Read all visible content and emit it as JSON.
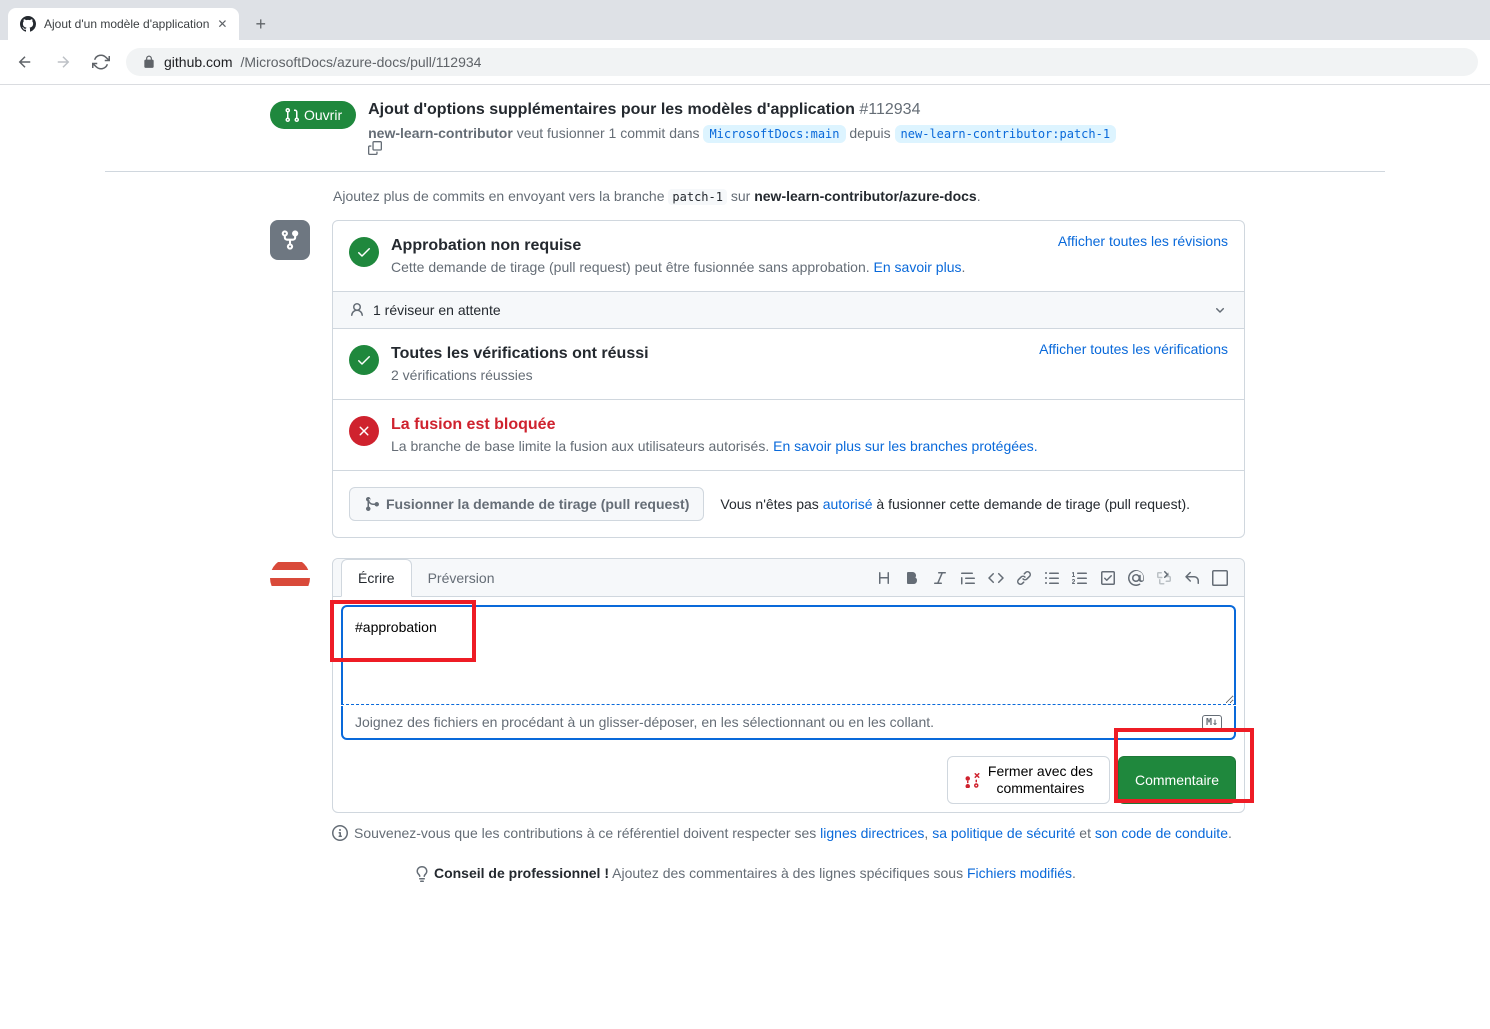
{
  "browser": {
    "tab_title": "Ajout d'un modèle d'application",
    "url_host": "github.com",
    "url_path": "/MicrosoftDocs/azure-docs/pull/112934"
  },
  "pr": {
    "status_label": "Ouvrir",
    "title": "Ajout d'options supplémentaires pour les modèles d'application",
    "number": "#112934",
    "author": "new-learn-contributor",
    "wants_merge": "veut fusionner 1 commit dans",
    "base_branch": "MicrosoftDocs:main",
    "from_word": "depuis",
    "head_branch": "new-learn-contributor:patch-1"
  },
  "commit_hint": {
    "prefix": "Ajoutez plus de commits en envoyant vers la branche",
    "branch": "patch-1",
    "on": "sur",
    "repo": "new-learn-contributor/azure-docs"
  },
  "approval": {
    "title": "Approbation non requise",
    "desc": "Cette demande de tirage (pull request) peut être fusionnée sans approbation.",
    "learn_more": "En savoir plus",
    "action": "Afficher toutes les révisions"
  },
  "reviewer_bar": "1 réviseur en attente",
  "checks": {
    "title": "Toutes les vérifications ont réussi",
    "desc": "2 vérifications réussies",
    "action": "Afficher toutes les vérifications"
  },
  "blocked": {
    "title": "La fusion est bloquée",
    "desc": "La branche de base limite la fusion aux utilisateurs autorisés.",
    "link": "En savoir plus sur les branches protégées."
  },
  "merge_button": "Fusionner la demande de tirage (pull request)",
  "merge_auth": {
    "prefix": "Vous n'êtes pas",
    "link": "autorisé",
    "suffix": "à fusionner cette demande de tirage (pull request)."
  },
  "comment": {
    "tab_write": "Écrire",
    "tab_preview": "Préversion",
    "textarea_value": "#approbation",
    "attach_hint": "Joignez des fichiers en procédant à un glisser-déposer, en les sélectionnant ou en les collant.",
    "close_line1": "Fermer avec des",
    "close_line2": "commentaires",
    "submit": "Commentaire"
  },
  "footer": {
    "text_prefix": "Souvenez-vous que les contributions à ce référentiel doivent respecter ses",
    "link1": "lignes directrices",
    "sep1": ",",
    "link2": "sa politique de sécurité",
    "sep2": "et",
    "link3": "son code de conduite"
  },
  "protip": {
    "label": "Conseil de professionnel !",
    "text": "Ajoutez des commentaires à des lignes spécifiques sous",
    "link": "Fichiers modifiés"
  }
}
